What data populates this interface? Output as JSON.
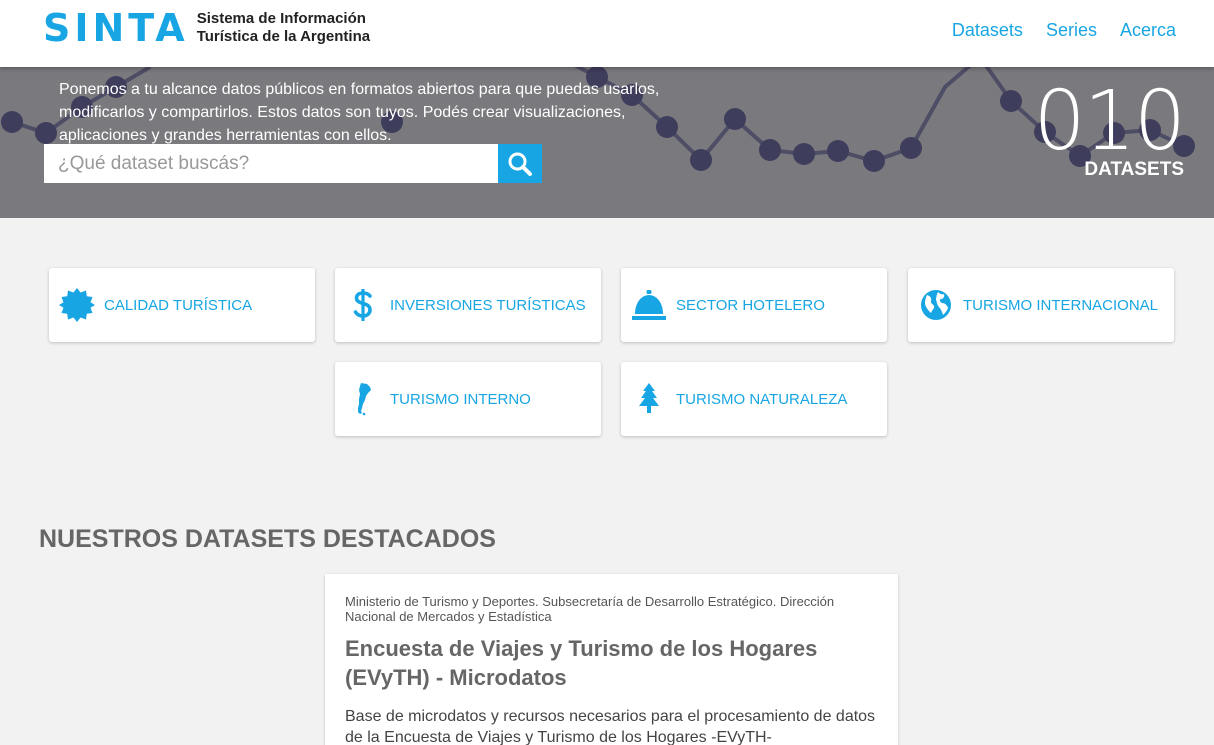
{
  "header": {
    "logo_mark": "SINTA",
    "logo_line1": "Sistema de Información",
    "logo_line2": "Turística de la Argentina",
    "nav": [
      "Datasets",
      "Series",
      "Acerca"
    ]
  },
  "hero": {
    "intro": "Ponemos a tu alcance datos públicos en formatos abiertos para que puedas usarlos, modificarlos y compartirlos. Estos datos son tuyos. Podés crear visualizaciones, aplicaciones y grandes herramientas con ellos.",
    "search_placeholder": "¿Qué dataset buscás?",
    "count": "010",
    "count_label": "DATASETS"
  },
  "categories": [
    {
      "label": "CALIDAD TURÍSTICA",
      "icon": "badge-icon"
    },
    {
      "label": "INVERSIONES TURÍSTICAS",
      "icon": "dollar-icon"
    },
    {
      "label": "SECTOR HOTELERO",
      "icon": "hotel-bell-icon"
    },
    {
      "label": "TURISMO INTERNACIONAL",
      "icon": "globe-icon"
    },
    {
      "label": "TURISMO INTERNO",
      "icon": "argentina-map-icon"
    },
    {
      "label": "TURISMO NATURALEZA",
      "icon": "tree-icon"
    }
  ],
  "featured": {
    "heading": "NUESTROS DATASETS DESTACADOS",
    "dataset": {
      "org": "Ministerio de Turismo y Deportes. Subsecretaría de Desarrollo Estratégico. Dirección Nacional de Mercados y Estadística",
      "title": "Encuesta de Viajes y Turismo de los Hogares (EVyTH) - Microdatos",
      "description": "Base de microdatos y recursos necesarios para el procesamiento de datos de la Encuesta de Viajes y Turismo de los Hogares -EVyTH-"
    }
  },
  "colors": {
    "accent": "#17a6e3",
    "hero_bg": "#7a7a7e",
    "dots": "#3e3d5c"
  }
}
